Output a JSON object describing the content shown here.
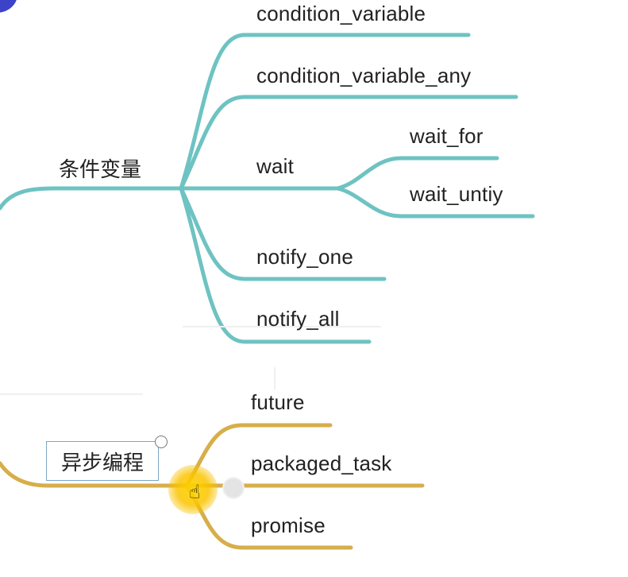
{
  "colors": {
    "teal_branch": "#6ec3c2",
    "gold_branch": "#d6ae4a",
    "text": "#222222",
    "topic_border": "#7da7c4",
    "accent": "#3c43c8"
  },
  "topics": {
    "condition_vars": {
      "label": "条件变量",
      "children": [
        {
          "label": "condition_variable"
        },
        {
          "label": "condition_variable_any"
        },
        {
          "label": "wait",
          "children": [
            {
              "label": "wait_for"
            },
            {
              "label": "wait_untiy"
            }
          ]
        },
        {
          "label": "notify_one"
        },
        {
          "label": "notify_all"
        }
      ]
    },
    "async_programming": {
      "label": "异步编程",
      "children": [
        {
          "label": "future"
        },
        {
          "label": "packaged_task"
        },
        {
          "label": "promise"
        }
      ]
    }
  },
  "icons": {
    "collapse_handle": "circle-outline-icon",
    "cursor": "hand-pointer-icon"
  }
}
